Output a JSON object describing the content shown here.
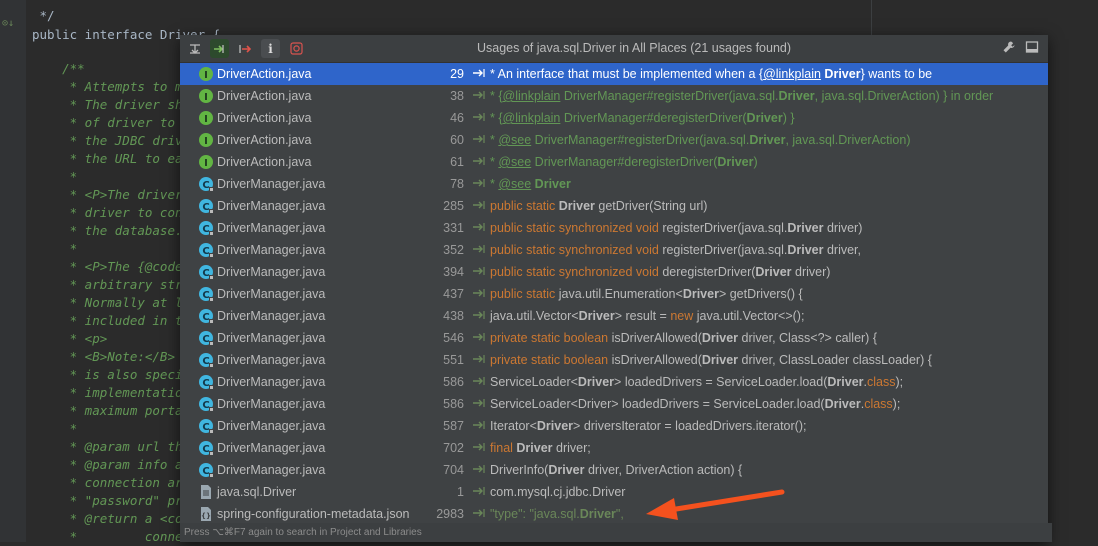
{
  "editor": {
    "lines": [
      {
        "text": " */"
      },
      {
        "text": "public interface Driver {"
      },
      {
        "text": ""
      },
      {
        "text": "    /**"
      },
      {
        "text": "     * Attempts to ma"
      },
      {
        "text": "     * The driver sho"
      },
      {
        "text": "     * of driver to c"
      },
      {
        "text": "     * the JDBC drive"
      },
      {
        "text": "     * the URL to eac"
      },
      {
        "text": "     *"
      },
      {
        "text": "     * <P>The driver "
      },
      {
        "text": "     * driver to conn"
      },
      {
        "text": "     * the database."
      },
      {
        "text": "     *"
      },
      {
        "text": "     * <P>The {@code "
      },
      {
        "text": "     * arbitrary stri"
      },
      {
        "text": "     * Normally at le"
      },
      {
        "text": "     * included in th"
      },
      {
        "text": "     * <p>"
      },
      {
        "text": "     * <B>Note:</B> I"
      },
      {
        "text": "     * is also specif"
      },
      {
        "text": "     * implementation"
      },
      {
        "text": "     * maximum portab"
      },
      {
        "text": "     *"
      },
      {
        "text": "     * @param url the"
      },
      {
        "text": "     * @param info a "
      },
      {
        "text": "     * connection arg"
      },
      {
        "text": "     * \"password\" pro"
      },
      {
        "text": "     * @return a <cod"
      },
      {
        "text": "     *         connec"
      }
    ]
  },
  "popup": {
    "title": "Usages of java.sql.Driver in All Places (21 usages found)",
    "footer": "Press ⌥⌘F7 again to search in Project and Libraries",
    "rows": [
      {
        "file": "DriverAction.java",
        "icon": "interface-icon",
        "line": "29",
        "selected": true,
        "tokens": [
          [
            "* An interface that must be implemented when a {",
            "c"
          ],
          [
            "@linkplain",
            "c u"
          ],
          [
            " ",
            "c"
          ],
          [
            "Driver",
            "c b"
          ],
          [
            "} wants to be",
            "c"
          ]
        ]
      },
      {
        "file": "DriverAction.java",
        "icon": "interface-icon",
        "line": "38",
        "tokens": [
          [
            "* {",
            "c"
          ],
          [
            "@linkplain",
            "c u"
          ],
          [
            " DriverManager#registerDriver(java.sql.",
            "c"
          ],
          [
            "Driver",
            "c b"
          ],
          [
            ", java.sql.DriverAction) } in order",
            "c"
          ]
        ]
      },
      {
        "file": "DriverAction.java",
        "icon": "interface-icon",
        "line": "46",
        "tokens": [
          [
            "* {",
            "c"
          ],
          [
            "@linkplain",
            "c u"
          ],
          [
            " DriverManager#deregisterDriver(",
            "c"
          ],
          [
            "Driver",
            "c b"
          ],
          [
            ") }",
            "c"
          ]
        ]
      },
      {
        "file": "DriverAction.java",
        "icon": "interface-icon",
        "line": "60",
        "tokens": [
          [
            "* ",
            "c"
          ],
          [
            "@see",
            "c u"
          ],
          [
            " DriverManager#registerDriver(java.sql.",
            "c"
          ],
          [
            "Driver",
            "c b"
          ],
          [
            ", java.sql.DriverAction)",
            "c"
          ]
        ]
      },
      {
        "file": "DriverAction.java",
        "icon": "interface-icon",
        "line": "61",
        "tokens": [
          [
            "* ",
            "c"
          ],
          [
            "@see",
            "c u"
          ],
          [
            " DriverManager#deregisterDriver(",
            "c"
          ],
          [
            "Driver",
            "c b"
          ],
          [
            ")",
            "c"
          ]
        ]
      },
      {
        "file": "DriverManager.java",
        "icon": "class-icon",
        "line": "78",
        "tokens": [
          [
            "* ",
            "c"
          ],
          [
            "@see",
            "c u"
          ],
          [
            " ",
            "c"
          ],
          [
            "Driver",
            "c b"
          ]
        ]
      },
      {
        "file": "DriverManager.java",
        "icon": "class-icon",
        "line": "285",
        "tokens": [
          [
            "public static ",
            "k"
          ],
          [
            "Driver",
            "p b"
          ],
          [
            " getDriver(String url)",
            "p"
          ]
        ]
      },
      {
        "file": "DriverManager.java",
        "icon": "class-icon",
        "line": "331",
        "tokens": [
          [
            "public static synchronized void ",
            "k"
          ],
          [
            "registerDriver(java.sql.",
            "p"
          ],
          [
            "Driver",
            "p b"
          ],
          [
            " driver)",
            "p"
          ]
        ]
      },
      {
        "file": "DriverManager.java",
        "icon": "class-icon",
        "line": "352",
        "tokens": [
          [
            "public static synchronized void ",
            "k"
          ],
          [
            "registerDriver(java.sql.",
            "p"
          ],
          [
            "Driver",
            "p b"
          ],
          [
            " driver,",
            "p"
          ]
        ]
      },
      {
        "file": "DriverManager.java",
        "icon": "class-icon",
        "line": "394",
        "tokens": [
          [
            "public static synchronized void ",
            "k"
          ],
          [
            "deregisterDriver(",
            "p"
          ],
          [
            "Driver",
            "p b"
          ],
          [
            " driver)",
            "p"
          ]
        ]
      },
      {
        "file": "DriverManager.java",
        "icon": "class-icon",
        "line": "437",
        "tokens": [
          [
            "public static ",
            "k"
          ],
          [
            "java.util.Enumeration<",
            "p"
          ],
          [
            "Driver",
            "p b"
          ],
          [
            "> getDrivers() {",
            "p"
          ]
        ]
      },
      {
        "file": "DriverManager.java",
        "icon": "class-icon",
        "line": "438",
        "tokens": [
          [
            "java.util.Vector<",
            "p"
          ],
          [
            "Driver",
            "p b"
          ],
          [
            "> result = ",
            "p"
          ],
          [
            "new ",
            "k"
          ],
          [
            "java.util.Vector<>();",
            "p"
          ]
        ]
      },
      {
        "file": "DriverManager.java",
        "icon": "class-icon",
        "line": "546",
        "tokens": [
          [
            "private static boolean ",
            "k"
          ],
          [
            "isDriverAllowed(",
            "p"
          ],
          [
            "Driver",
            "p b"
          ],
          [
            " driver, Class<?> caller) {",
            "p"
          ]
        ]
      },
      {
        "file": "DriverManager.java",
        "icon": "class-icon",
        "line": "551",
        "tokens": [
          [
            "private static boolean ",
            "k"
          ],
          [
            "isDriverAllowed(",
            "p"
          ],
          [
            "Driver",
            "p b"
          ],
          [
            " driver, ClassLoader classLoader) {",
            "p"
          ]
        ]
      },
      {
        "file": "DriverManager.java",
        "icon": "class-icon",
        "line": "586",
        "tokens": [
          [
            "ServiceLoader<",
            "p"
          ],
          [
            "Driver",
            "p b"
          ],
          [
            "> loadedDrivers = ServiceLoader.load(",
            "p"
          ],
          [
            "Driver",
            "p b"
          ],
          [
            ".",
            "p"
          ],
          [
            "class",
            "k"
          ],
          [
            ");",
            "p"
          ]
        ]
      },
      {
        "file": "DriverManager.java",
        "icon": "class-icon",
        "line": "586",
        "tokens": [
          [
            "ServiceLoader<Driver> loadedDrivers = ServiceLoader.load(",
            "p"
          ],
          [
            "Driver",
            "p b"
          ],
          [
            ".",
            "p"
          ],
          [
            "class",
            "k"
          ],
          [
            ");",
            "p"
          ]
        ]
      },
      {
        "file": "DriverManager.java",
        "icon": "class-icon",
        "line": "587",
        "tokens": [
          [
            "Iterator<",
            "p"
          ],
          [
            "Driver",
            "p b"
          ],
          [
            "> driversIterator = loadedDrivers.iterator();",
            "p"
          ]
        ]
      },
      {
        "file": "DriverManager.java",
        "icon": "class-icon",
        "line": "702",
        "tokens": [
          [
            "final ",
            "k"
          ],
          [
            "Driver",
            "p b"
          ],
          [
            " driver;",
            "p"
          ]
        ]
      },
      {
        "file": "DriverManager.java",
        "icon": "class-icon",
        "line": "704",
        "tokens": [
          [
            "DriverInfo(",
            "p"
          ],
          [
            "Driver",
            "p b"
          ],
          [
            " driver, DriverAction action) {",
            "p"
          ]
        ]
      },
      {
        "file": "java.sql.Driver",
        "icon": "text-file-icon",
        "line": "1",
        "tokens": [
          [
            "com.mysql.cj.jdbc.Driver",
            "p"
          ]
        ]
      },
      {
        "file": "spring-configuration-metadata.json",
        "icon": "json-file-icon",
        "line": "2983",
        "tokens": [
          [
            "\"type\": \"java.sql.",
            "s"
          ],
          [
            "Driver",
            "s b"
          ],
          [
            "\",",
            "s"
          ]
        ]
      }
    ]
  },
  "colors": {
    "selection": "#2f65ca",
    "annotation_arrow": "#f4511e"
  }
}
